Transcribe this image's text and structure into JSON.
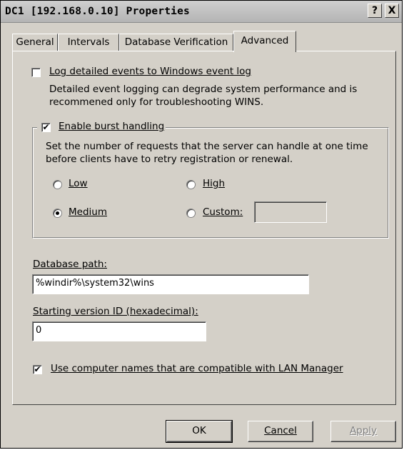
{
  "window": {
    "title": "DC1 [192.168.0.10] Properties",
    "help_glyph": "?",
    "close_glyph": "X"
  },
  "tabs": [
    {
      "label": "General",
      "active": false
    },
    {
      "label": "Intervals",
      "active": false
    },
    {
      "label": "Database Verification",
      "active": false
    },
    {
      "label": "Advanced",
      "active": true
    }
  ],
  "advanced": {
    "log_events": {
      "label": "Log detailed events to Windows event log",
      "checked": false,
      "description_line1": "Detailed event logging can degrade system performance and is",
      "description_line2": "recommened only for troubleshooting WINS."
    },
    "burst": {
      "label": "Enable burst handling",
      "checked": true,
      "description_line1": "Set the number of requests that the server can handle at one time",
      "description_line2": "before clients have to retry registration or renewal.",
      "options": {
        "low": {
          "label": "Low",
          "selected": false
        },
        "high": {
          "label": "High",
          "selected": false
        },
        "medium": {
          "label": "Medium",
          "selected": true
        },
        "custom": {
          "label": "Custom:",
          "selected": false,
          "value": ""
        }
      }
    },
    "database_path": {
      "label": "Database path:",
      "value": "%windir%\\system32\\wins"
    },
    "starting_version": {
      "label": "Starting version ID (hexadecimal):",
      "value": "0"
    },
    "lan_manager": {
      "label": "Use computer names that are compatible with LAN Manager",
      "checked": true
    }
  },
  "buttons": {
    "ok": "OK",
    "cancel": "Cancel",
    "apply": "Apply"
  }
}
